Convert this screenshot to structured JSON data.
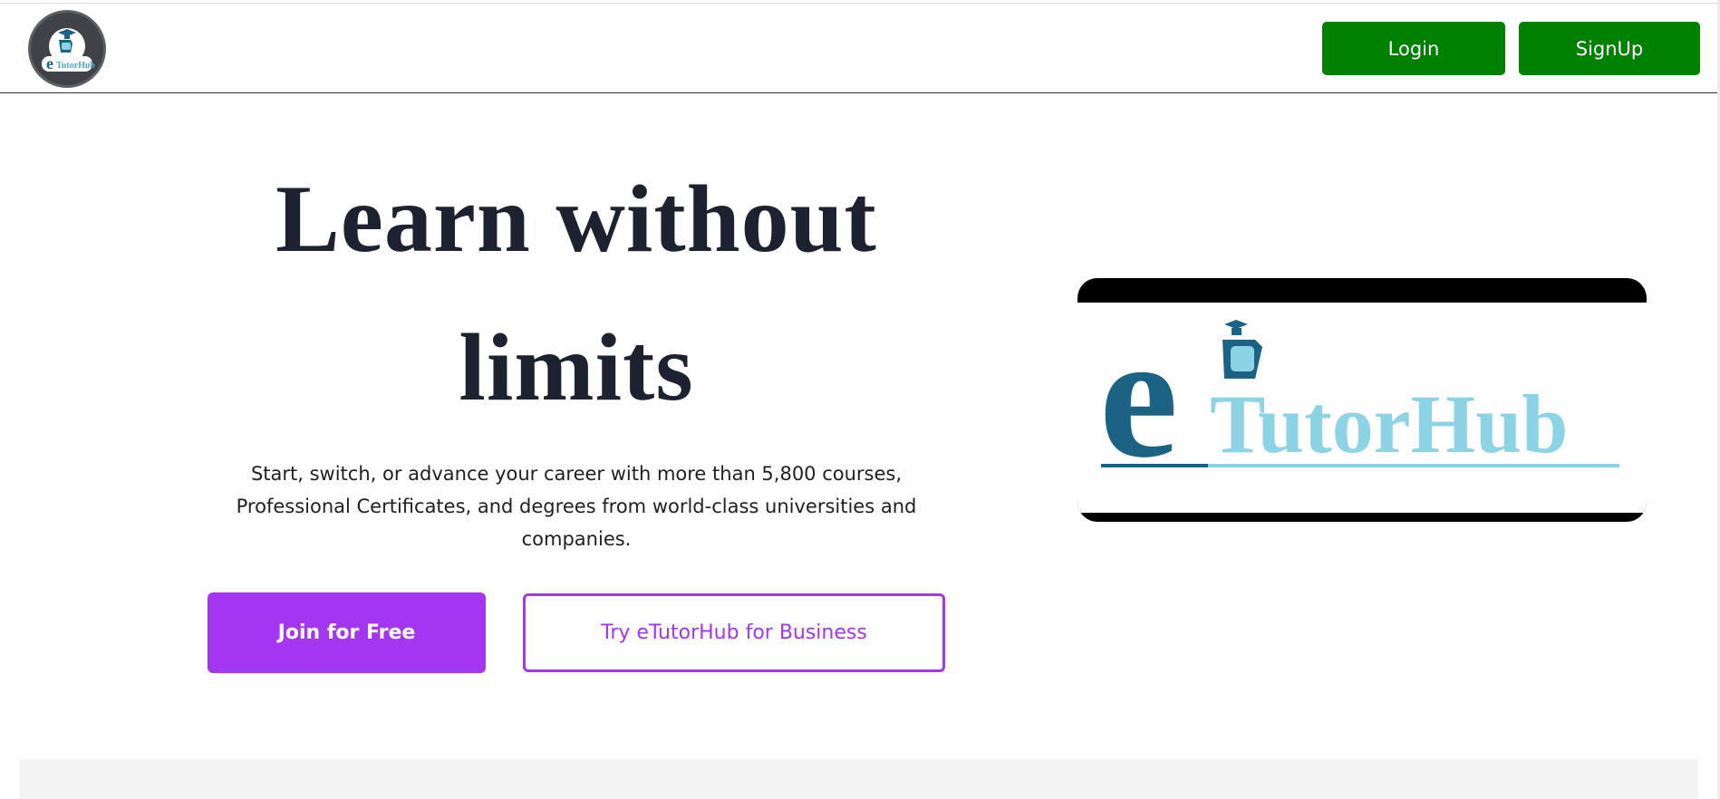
{
  "header": {
    "logo_icon": "etutorhub-logo-icon",
    "logo_text": "eTutorHub",
    "login_label": "Login",
    "signup_label": "SignUp"
  },
  "hero": {
    "title_line1": "Learn without",
    "title_line2": "limits",
    "subtitle": "Start, switch, or advance your career with more than 5,800 courses, Professional Certificates, and degrees from world-class universities and companies.",
    "join_label": "Join for Free",
    "business_label": "Try eTutorHub for Business"
  },
  "brand_image": {
    "letter_e": "e",
    "wordmark": "TutorHub"
  },
  "colors": {
    "nav_button": "#008000",
    "primary_cta": "#a435f0",
    "title_text": "#1c2230",
    "brand_dark": "#1a6385",
    "brand_light": "#8dd3e6"
  }
}
